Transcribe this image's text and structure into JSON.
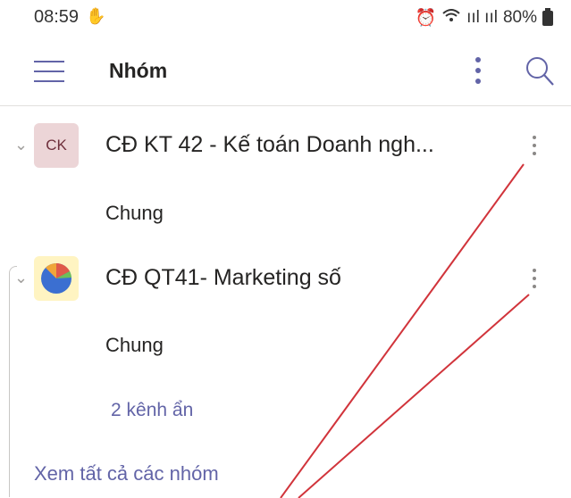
{
  "status_bar": {
    "time": "08:59",
    "left_icon": "hand-icon",
    "signal_text": "ııl ııl",
    "battery_percent": "80%"
  },
  "appbar": {
    "title": "Nhóm"
  },
  "teams": [
    {
      "avatar_text": "CK",
      "name": "CĐ KT 42 - Kế toán Doanh ngh...",
      "channel": "Chung"
    },
    {
      "avatar_icon": "pie-chart-icon",
      "name": "CĐ QT41- Marketing số",
      "channel": "Chung",
      "hidden_channels": "2 kênh ẩn"
    }
  ],
  "see_all": "Xem tất cả các nhóm",
  "colors": {
    "accent": "#6264a7",
    "annotation": "#d1343b"
  }
}
